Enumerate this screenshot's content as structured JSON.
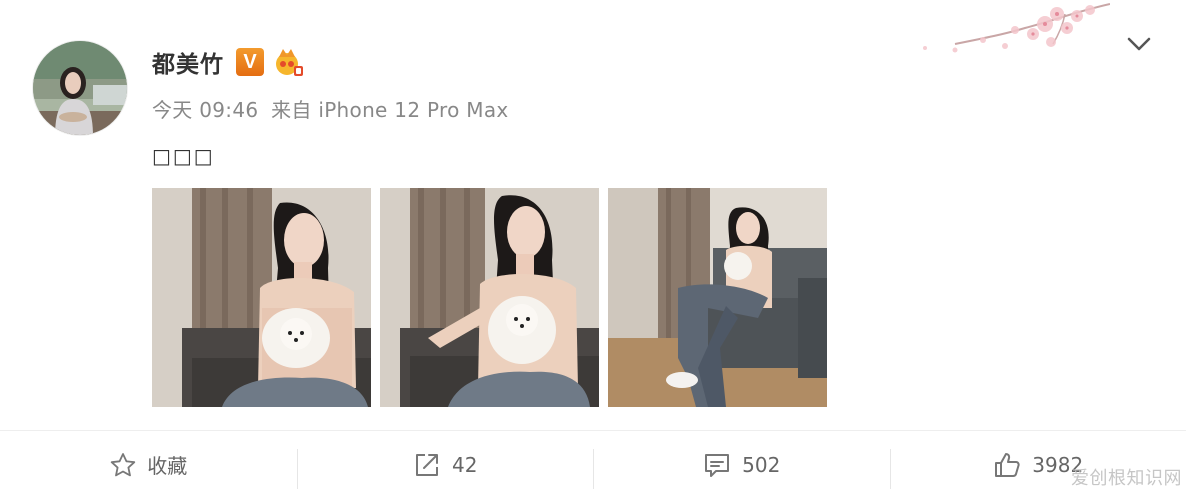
{
  "post": {
    "username": "都美竹",
    "verified_badge": "V",
    "time": "今天 09:46",
    "source": "来自 iPhone 12 Pro Max",
    "text": "□□□",
    "photos": [
      {
        "icon": "photo-woman-holding-white-dog-1"
      },
      {
        "icon": "photo-woman-holding-white-dog-2"
      },
      {
        "icon": "photo-woman-sitting-on-sofa"
      }
    ]
  },
  "actions": {
    "favorite_label": "收藏",
    "repost_count": "42",
    "comment_count": "502",
    "like_count": "3982"
  },
  "watermark": "爱创根知识网",
  "colors": {
    "accent_orange": "#e8781a",
    "text_gray": "#888888",
    "icon_gray": "#666666"
  }
}
